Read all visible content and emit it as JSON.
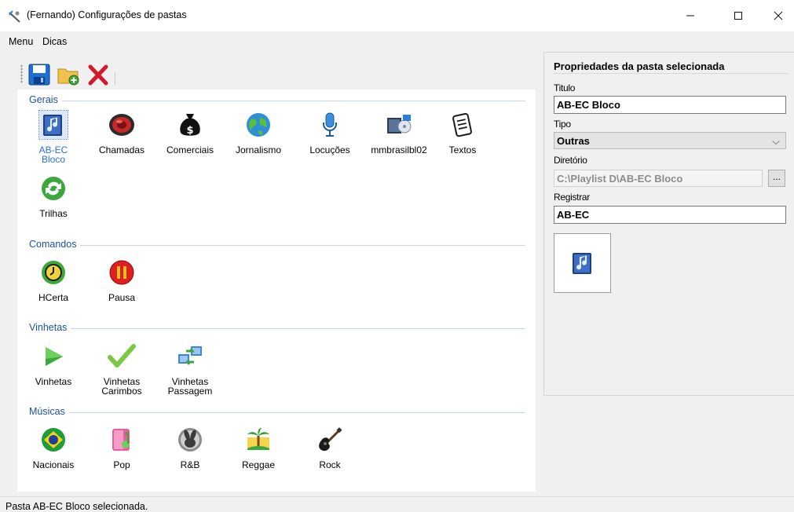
{
  "window": {
    "title": "(Fernando) Configurações de pastas"
  },
  "menu": {
    "items": [
      "Menu",
      "Dicas"
    ]
  },
  "toolbar": {
    "buttons": [
      "save-icon",
      "new-folder-icon",
      "delete-icon"
    ]
  },
  "groups": [
    {
      "title": "Gerais",
      "items": [
        {
          "label": "AB-EC Bloco",
          "icon": "music-file-icon",
          "selected": true
        },
        {
          "label": "Chamadas",
          "icon": "speaker-icon"
        },
        {
          "label": "Comerciais",
          "icon": "money-bag-icon"
        },
        {
          "label": "Jornalismo",
          "icon": "globe-icon"
        },
        {
          "label": "Locuções",
          "icon": "microphone-icon"
        },
        {
          "label": "mmbrasilbl02",
          "icon": "media-folder-icon"
        },
        {
          "label": "Textos",
          "icon": "text-document-icon"
        },
        {
          "label": "Trilhas",
          "icon": "refresh-icon"
        }
      ]
    },
    {
      "title": "Comandos",
      "items": [
        {
          "label": "HCerta",
          "icon": "clock-icon"
        },
        {
          "label": "Pausa",
          "icon": "pause-icon"
        }
      ]
    },
    {
      "title": "Vinhetas",
      "items": [
        {
          "label": "Vinhetas",
          "icon": "play-icon"
        },
        {
          "label": "Vinhetas Carimbos",
          "icon": "checkmark-icon"
        },
        {
          "label": "Vinhetas Passagem",
          "icon": "transfer-icon"
        }
      ]
    },
    {
      "title": "Músicas",
      "items": [
        {
          "label": "Nacionais",
          "icon": "brazil-flag-icon"
        },
        {
          "label": "Pop",
          "icon": "pop-music-icon"
        },
        {
          "label": "R&B",
          "icon": "bunny-icon"
        },
        {
          "label": "Reggae",
          "icon": "palm-tree-icon"
        },
        {
          "label": "Rock",
          "icon": "guitar-icon"
        }
      ]
    }
  ],
  "properties": {
    "title": "Propriedades da pasta selecionada",
    "titulo_label": "Titulo",
    "titulo_value": "AB-EC Bloco",
    "tipo_label": "Tipo",
    "tipo_value": "Outras",
    "diretorio_label": "Diretório",
    "diretorio_value": "C:\\Playlist D\\AB-EC Bloco",
    "browse_label": "...",
    "registrar_label": "Registrar",
    "registrar_value": "AB-EC",
    "preview_icon": "music-file-icon"
  },
  "status": {
    "text": "Pasta AB-EC Bloco selecionada."
  }
}
